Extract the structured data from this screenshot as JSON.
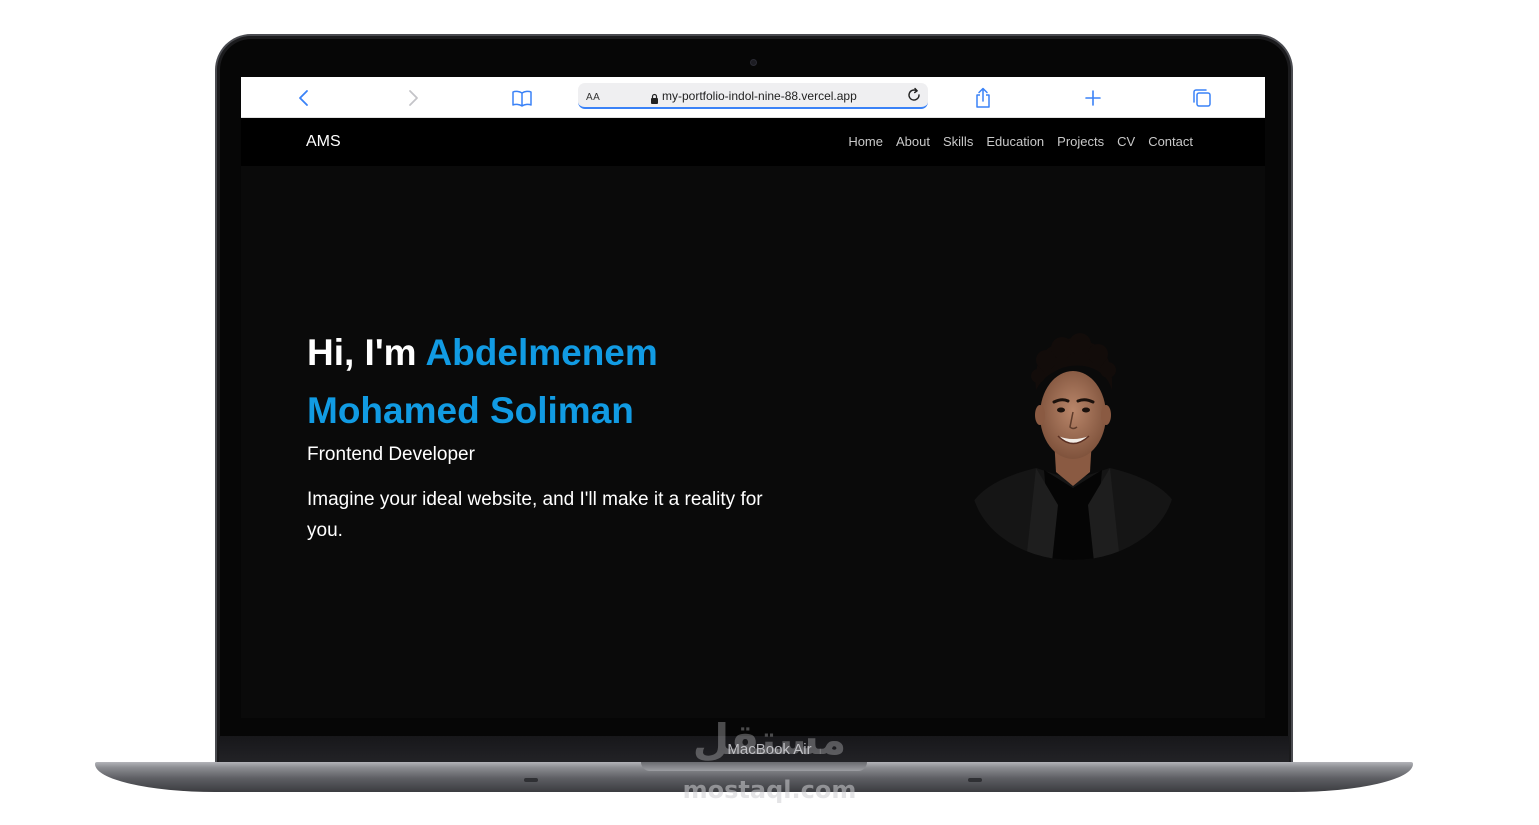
{
  "browser": {
    "address_bar": {
      "text_size_label": "AA",
      "url": "my-portfolio-indol-nine-88.vercel.app"
    },
    "icons": {
      "back": "chevron-left-icon",
      "forward": "chevron-right-icon",
      "bookmarks": "book-icon",
      "lock": "lock-icon",
      "reload": "reload-icon",
      "share": "share-icon",
      "new_tab": "plus-icon",
      "tabs": "tabs-icon"
    },
    "accent_color": "#3a82f7"
  },
  "site": {
    "brand": "AMS",
    "nav": [
      "Home",
      "About",
      "Skills",
      "Education",
      "Projects",
      "CV",
      "Contact"
    ],
    "hero": {
      "greeting": "Hi, I'm ",
      "name": "Abdelmenem Mohamed Soliman",
      "role": "Frontend Developer",
      "tagline": "Imagine your ideal website, and I'll make it a reality for you."
    },
    "colors": {
      "background": "#0a0a0a",
      "accent": "#119be3",
      "nav_background": "#000000"
    }
  },
  "device": {
    "label": "MacBook Air"
  },
  "watermark": {
    "logo_text": "مستقل",
    "domain": "mostaql.com"
  }
}
